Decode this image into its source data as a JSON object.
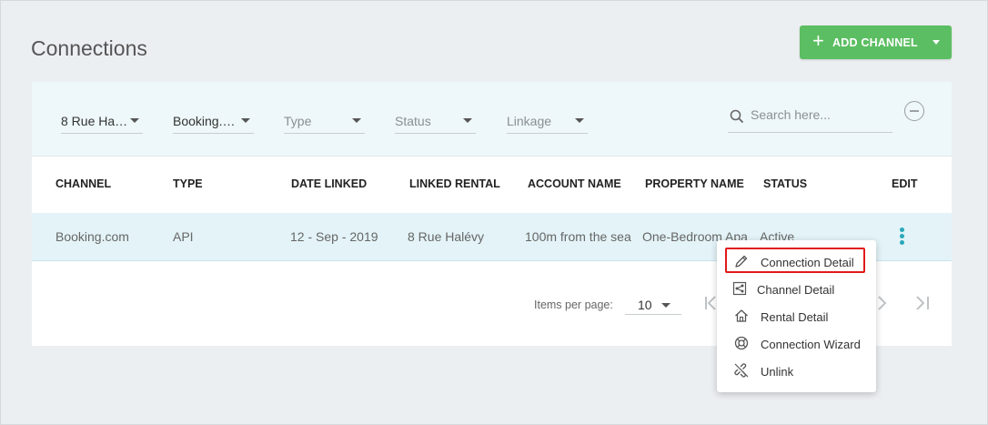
{
  "page": {
    "title": "Connections"
  },
  "add_button": {
    "label": "ADD CHANNEL",
    "plus": "+"
  },
  "filters": [
    {
      "value": "8 Rue Ha…"
    },
    {
      "value": "Booking.…"
    },
    {
      "placeholder": "Type"
    },
    {
      "placeholder": "Status"
    },
    {
      "placeholder": "Linkage"
    }
  ],
  "search": {
    "placeholder": "Search here..."
  },
  "table": {
    "columns": [
      "CHANNEL",
      "TYPE",
      "DATE LINKED",
      "LINKED RENTAL",
      "ACCOUNT NAME",
      "PROPERTY NAME",
      "STATUS",
      "EDIT"
    ],
    "rows": [
      {
        "channel": "Booking.com",
        "type": "API",
        "date_linked": "12 - Sep - 2019",
        "linked_rental": "8 Rue Halévy",
        "account_name": "100m from the sea",
        "property_name": "One-Bedroom Apa",
        "status": "Active"
      }
    ]
  },
  "pagination": {
    "items_per_page_label": "Items per page:",
    "items_per_page": "10"
  },
  "context_menu": {
    "items": [
      {
        "label": "Connection Detail",
        "icon": "pencil-icon"
      },
      {
        "label": "Channel Detail",
        "icon": "share-icon"
      },
      {
        "label": "Rental Detail",
        "icon": "home-icon"
      },
      {
        "label": "Connection Wizard",
        "icon": "lifebuoy-icon"
      },
      {
        "label": "Unlink",
        "icon": "unlink-icon"
      }
    ],
    "highlighted_index": 0,
    "highlight_color": "#e01b1b"
  },
  "colors": {
    "accent": "#5cbe62",
    "kebab": "#2aa8b9",
    "row_bg": "#e3f3f7",
    "filter_bg": "#eef7f9"
  }
}
